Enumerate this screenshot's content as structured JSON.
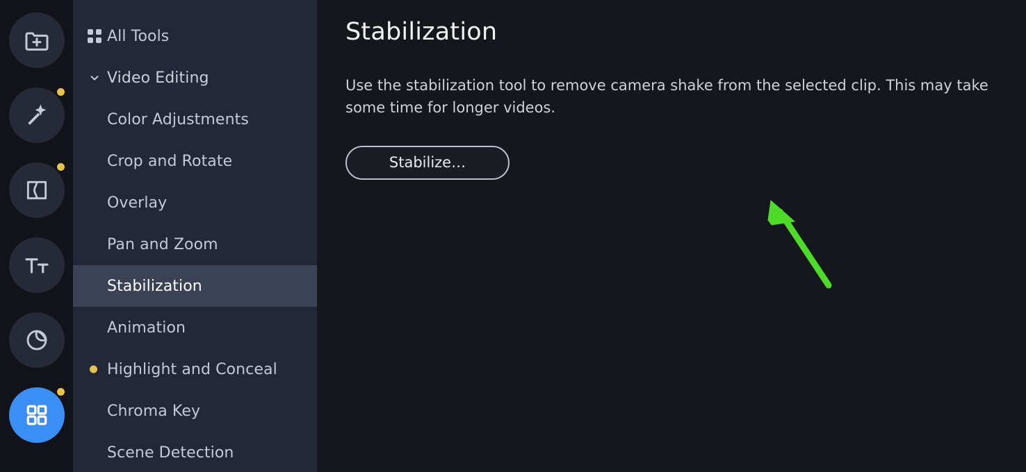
{
  "rail": {
    "items": [
      {
        "name": "add-media",
        "icon": "folder-plus-icon",
        "badge": false,
        "active": false
      },
      {
        "name": "effects",
        "icon": "magic-wand-icon",
        "badge": true,
        "active": false
      },
      {
        "name": "transitions",
        "icon": "transition-icon",
        "badge": true,
        "active": false
      },
      {
        "name": "titles",
        "icon": "text-icon",
        "badge": false,
        "active": false
      },
      {
        "name": "filters",
        "icon": "color-filter-icon",
        "badge": false,
        "active": false
      },
      {
        "name": "all-tools",
        "icon": "grid-icon",
        "badge": true,
        "active": true
      }
    ]
  },
  "sidebar": {
    "all_tools_label": "All Tools",
    "group_label": "Video Editing",
    "items": [
      {
        "label": "Color Adjustments",
        "selected": false,
        "badge": false
      },
      {
        "label": "Crop and Rotate",
        "selected": false,
        "badge": false
      },
      {
        "label": "Overlay",
        "selected": false,
        "badge": false
      },
      {
        "label": "Pan and Zoom",
        "selected": false,
        "badge": false
      },
      {
        "label": "Stabilization",
        "selected": true,
        "badge": false
      },
      {
        "label": "Animation",
        "selected": false,
        "badge": false
      },
      {
        "label": "Highlight and Conceal",
        "selected": false,
        "badge": true
      },
      {
        "label": "Chroma Key",
        "selected": false,
        "badge": false
      },
      {
        "label": "Scene Detection",
        "selected": false,
        "badge": false
      }
    ]
  },
  "main": {
    "title": "Stabilization",
    "description": "Use the stabilization tool to remove camera shake from the selected clip. This may take some time for longer videos.",
    "button_label": "Stabilize…"
  },
  "annotation": {
    "arrow_color": "#4ddb2a"
  },
  "colors": {
    "accent_blue": "#3b8ef4",
    "badge_amber": "#e6c349",
    "selected_row": "#3c4256",
    "sidebar_bg": "#232838",
    "content_bg": "#15171d"
  }
}
